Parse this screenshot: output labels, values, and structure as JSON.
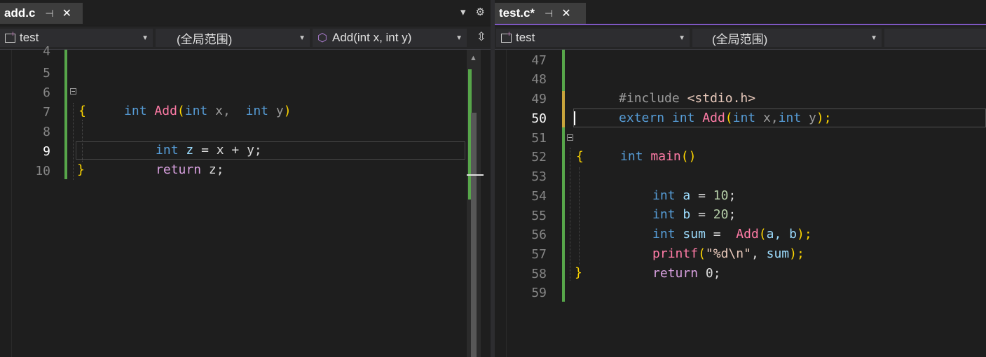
{
  "left": {
    "tab": {
      "name": "add.c",
      "pin": "⊣",
      "close": "✕"
    },
    "tools": {
      "dropdown": "▾",
      "gear": "⚙"
    },
    "nav": {
      "project": "test",
      "scope": "(全局范围)",
      "member": "Add(int x, int y)"
    },
    "lines": [
      {
        "n": "4"
      },
      {
        "n": "5"
      },
      {
        "n": "6"
      },
      {
        "n": "7"
      },
      {
        "n": "8"
      },
      {
        "n": "9"
      },
      {
        "n": "10"
      }
    ],
    "code": {
      "l6_int": "int",
      "l6_fn": "Add",
      "l6_paren": "(",
      "l6_int2": "int",
      "l6_x": "x,",
      "l6_int3": "int",
      "l6_y": "y",
      "l6_close": ")",
      "l7": "{",
      "l8_int": "int",
      "l8_z": "z",
      "l8_rest": " = x + y;",
      "l9_ret": "return",
      "l9_rest": " z;",
      "l10": "}"
    }
  },
  "right": {
    "tab": {
      "name": "test.c*",
      "pin": "⊣",
      "close": "✕"
    },
    "nav": {
      "project": "test",
      "scope": "(全局范围)"
    },
    "lines": [
      {
        "n": "47"
      },
      {
        "n": "48"
      },
      {
        "n": "49"
      },
      {
        "n": "50"
      },
      {
        "n": "51"
      },
      {
        "n": "52"
      },
      {
        "n": "53"
      },
      {
        "n": "54"
      },
      {
        "n": "55"
      },
      {
        "n": "56"
      },
      {
        "n": "57"
      },
      {
        "n": "58"
      },
      {
        "n": "59"
      }
    ],
    "code": {
      "l48_inc": "#include ",
      "l48_hdr": "<stdio.h>",
      "l49_ext": "extern",
      "l49_int": "int",
      "l49_fn": "Add",
      "l49_open": "(",
      "l49_int2": "int",
      "l49_x": "x,",
      "l49_int3": "int",
      "l49_y": "y",
      "l49_end": ");",
      "l51_int": "int",
      "l51_fn": "main",
      "l51_paren": "()",
      "l52": "{",
      "l53_int": "int",
      "l53_a": "a",
      "l53_eq": " = ",
      "l53_num": "10",
      "l53_semi": ";",
      "l54_int": "int",
      "l54_b": "b",
      "l54_eq": " = ",
      "l54_num": "20",
      "l54_semi": ";",
      "l55_int": "int",
      "l55_sum": "sum",
      "l55_eq": " =  ",
      "l55_fn": "Add",
      "l55_open": "(",
      "l55_args": "a, b",
      "l55_end": ");",
      "l56_fn": "printf",
      "l56_open": "(",
      "l56_str": "\"%d\\n\"",
      "l56_comma": ", ",
      "l56_sum": "sum",
      "l56_end": ");",
      "l57_ret": "return",
      "l57_rest": " 0;",
      "l58": "}"
    }
  }
}
